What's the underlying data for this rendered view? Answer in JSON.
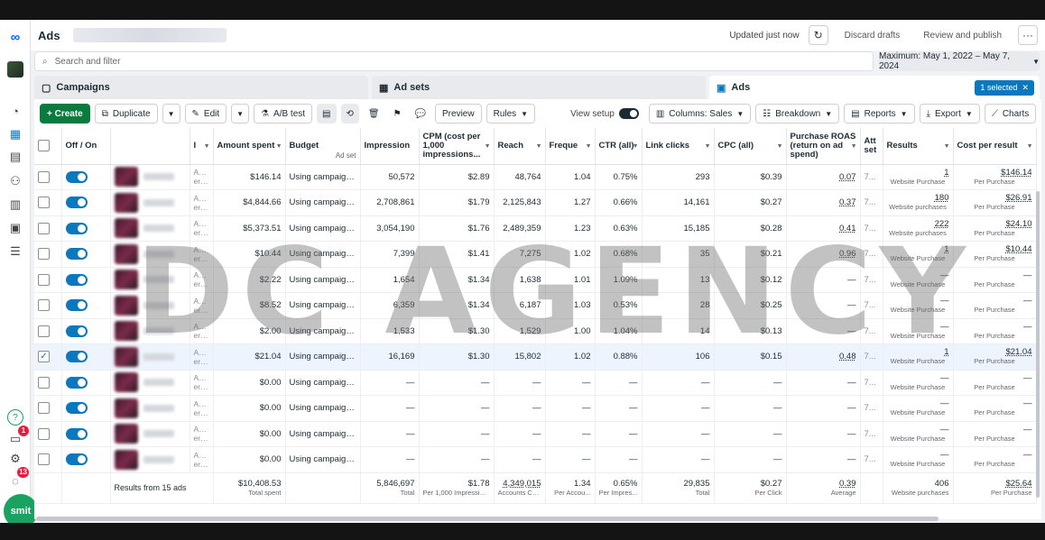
{
  "header": {
    "title": "Ads",
    "updated": "Updated just now",
    "discard": "Discard drafts",
    "review": "Review and publish",
    "more": "···"
  },
  "search": {
    "placeholder": "Search and filter"
  },
  "date_range": "Maximum: May 1, 2022 – May 7, 2024",
  "tabs": {
    "campaigns": "Campaigns",
    "adsets": "Ad sets",
    "ads": "Ads",
    "selected": "1 selected",
    "selected_close": "✕"
  },
  "toolbar": {
    "create": "+ Create",
    "duplicate": "Duplicate",
    "edit": "Edit",
    "ab_test": "A/B test",
    "preview": "Preview",
    "rules": "Rules",
    "view_setup": "View setup",
    "columns": "Columns: Sales",
    "breakdown": "Breakdown",
    "reports": "Reports",
    "export": "Export",
    "charts": "Charts"
  },
  "columns": {
    "offon": "Off / On",
    "delivery": "I",
    "amount_spent": "Amount spent",
    "budget": "Budget",
    "budget_sub": "Ad set",
    "impressions": "Impression",
    "cpm": "CPM (cost per 1,000 impressions...",
    "reach": "Reach",
    "frequency": "Freque",
    "ctr": "CTR (all)",
    "link_clicks": "Link clicks",
    "cpc": "CPC (all)",
    "roas": "Purchase ROAS (return on ad spend)",
    "attr": "Att set",
    "results": "Results",
    "cost_per_result": "Cost per result"
  },
  "rows": [
    {
      "checked": false,
      "status": "Acco error",
      "spent": "$146.14",
      "budget": "Using campaign ...",
      "imp": "50,572",
      "cpm": "$2.89",
      "reach": "48,764",
      "freq": "1.04",
      "ctr": "0.75%",
      "clicks": "293",
      "cpc": "$0.39",
      "roas": "0.07",
      "attr": "7...",
      "result": "1",
      "result_sub": "Website Purchase",
      "cpr": "$146.14",
      "cpr_sub": "Per Purchase"
    },
    {
      "checked": false,
      "status": "Acco error",
      "spent": "$4,844.66",
      "budget": "Using campaign ...",
      "imp": "2,708,861",
      "cpm": "$1.79",
      "reach": "2,125,843",
      "freq": "1.27",
      "ctr": "0.66%",
      "clicks": "14,161",
      "cpc": "$0.27",
      "roas": "0.37",
      "attr": "7...",
      "result": "180",
      "result_sub": "Website purchases",
      "cpr": "$26.91",
      "cpr_sub": "Per Purchase"
    },
    {
      "checked": false,
      "status": "Acco error",
      "spent": "$5,373.51",
      "budget": "Using campaign ...",
      "imp": "3,054,190",
      "cpm": "$1.76",
      "reach": "2,489,359",
      "freq": "1.23",
      "ctr": "0.63%",
      "clicks": "15,185",
      "cpc": "$0.28",
      "roas": "0.41",
      "attr": "7...",
      "result": "222",
      "result_sub": "Website purchases",
      "cpr": "$24.10",
      "cpr_sub": "Per Purchase"
    },
    {
      "checked": false,
      "status": "Acco error",
      "spent": "$10.44",
      "budget": "Using campaign ...",
      "imp": "7,399",
      "cpm": "$1.41",
      "reach": "7,275",
      "freq": "1.02",
      "ctr": "0.68%",
      "clicks": "35",
      "cpc": "$0.21",
      "roas": "0.96",
      "attr": "7...",
      "result": "1",
      "result_sub": "Website Purchase",
      "cpr": "$10.44",
      "cpr_sub": "Per Purchase"
    },
    {
      "checked": false,
      "status": "Acco error",
      "spent": "$2.22",
      "budget": "Using campaign ...",
      "imp": "1,654",
      "cpm": "$1.34",
      "reach": "1,638",
      "freq": "1.01",
      "ctr": "1.09%",
      "clicks": "13",
      "cpc": "$0.12",
      "roas": "—",
      "attr": "7...",
      "result": "—",
      "result_sub": "Website Purchase",
      "cpr": "—",
      "cpr_sub": "Per Purchase"
    },
    {
      "checked": false,
      "status": "Acco error",
      "spent": "$8.52",
      "budget": "Using campaign ...",
      "imp": "6,359",
      "cpm": "$1.34",
      "reach": "6,187",
      "freq": "1.03",
      "ctr": "0.53%",
      "clicks": "28",
      "cpc": "$0.25",
      "roas": "—",
      "attr": "7...",
      "result": "—",
      "result_sub": "Website Purchase",
      "cpr": "—",
      "cpr_sub": "Per Purchase"
    },
    {
      "checked": false,
      "status": "Acco error",
      "spent": "$2.00",
      "budget": "Using campaign ...",
      "imp": "1,533",
      "cpm": "$1.30",
      "reach": "1,529",
      "freq": "1.00",
      "ctr": "1.04%",
      "clicks": "14",
      "cpc": "$0.13",
      "roas": "—",
      "attr": "7...",
      "result": "—",
      "result_sub": "Website Purchase",
      "cpr": "—",
      "cpr_sub": "Per Purchase"
    },
    {
      "checked": true,
      "status": "Acco error",
      "spent": "$21.04",
      "budget": "Using campaign ...",
      "imp": "16,169",
      "cpm": "$1.30",
      "reach": "15,802",
      "freq": "1.02",
      "ctr": "0.88%",
      "clicks": "106",
      "cpc": "$0.15",
      "roas": "0.48",
      "attr": "7...",
      "result": "1",
      "result_sub": "Website Purchase",
      "cpr": "$21.04",
      "cpr_sub": "Per Purchase"
    },
    {
      "checked": false,
      "status": "Acco error",
      "spent": "$0.00",
      "budget": "Using campaign ...",
      "imp": "—",
      "cpm": "—",
      "reach": "—",
      "freq": "—",
      "ctr": "—",
      "clicks": "—",
      "cpc": "—",
      "roas": "—",
      "attr": "7...",
      "result": "—",
      "result_sub": "Website Purchase",
      "cpr": "—",
      "cpr_sub": "Per Purchase"
    },
    {
      "checked": false,
      "status": "Acco error",
      "spent": "$0.00",
      "budget": "Using campaign ...",
      "imp": "—",
      "cpm": "—",
      "reach": "—",
      "freq": "—",
      "ctr": "—",
      "clicks": "—",
      "cpc": "—",
      "roas": "—",
      "attr": "7...",
      "result": "—",
      "result_sub": "Website Purchase",
      "cpr": "—",
      "cpr_sub": "Per Purchase"
    },
    {
      "checked": false,
      "status": "Acco error",
      "spent": "$0.00",
      "budget": "Using campaign ...",
      "imp": "—",
      "cpm": "—",
      "reach": "—",
      "freq": "—",
      "ctr": "—",
      "clicks": "—",
      "cpc": "—",
      "roas": "—",
      "attr": "7...",
      "result": "—",
      "result_sub": "Website Purchase",
      "cpr": "—",
      "cpr_sub": "Per Purchase"
    },
    {
      "checked": false,
      "status": "Acco error",
      "spent": "$0.00",
      "budget": "Using campaign ...",
      "imp": "—",
      "cpm": "—",
      "reach": "—",
      "freq": "—",
      "ctr": "—",
      "clicks": "—",
      "cpc": "—",
      "roas": "—",
      "attr": "7...",
      "result": "—",
      "result_sub": "Website Purchase",
      "cpr": "—",
      "cpr_sub": "Per Purchase"
    }
  ],
  "footer": {
    "label": "Results from 15 ads",
    "spent": "$10,408.53",
    "spent_sub": "Total spent",
    "imp": "5,846,697",
    "imp_sub": "Total",
    "cpm": "$1.78",
    "cpm_sub": "Per 1,000 Impressions",
    "reach": "4,349,015",
    "reach_sub": "Accounts Ce...",
    "freq": "1.34",
    "freq_sub": "Per Accou...",
    "ctr": "0.65%",
    "ctr_sub": "Per Impres...",
    "clicks": "29,835",
    "clicks_sub": "Total",
    "cpc": "$0.27",
    "cpc_sub": "Per Click",
    "roas": "0.39",
    "roas_sub": "Average",
    "result": "406",
    "result_sub": "Website purchases",
    "cpr": "$25.64",
    "cpr_sub": "Per Purchase"
  },
  "watermark": "DC AGENCY",
  "rail": {
    "notif_badge": "1",
    "alert_badge": "13",
    "help": "?",
    "smit": "smit"
  },
  "colors": {
    "brand_blue": "#0a78be",
    "create_green": "#0a7b3e",
    "badge_red": "#e41e3f"
  }
}
